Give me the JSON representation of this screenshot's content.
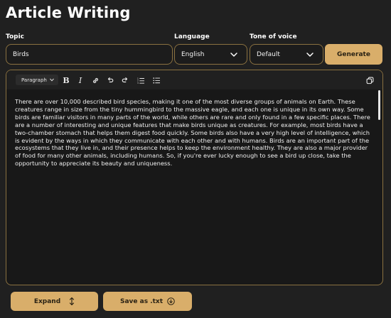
{
  "page": {
    "title": "Article Writing"
  },
  "topic": {
    "label": "Topic",
    "value": "Birds"
  },
  "language": {
    "label": "Language",
    "value": "English"
  },
  "tone": {
    "label": "Tone of voice",
    "value": "Default"
  },
  "generate_label": "Generate",
  "toolbar": {
    "format_value": "Paragraph",
    "icons": [
      "bold-icon",
      "italic-icon",
      "link-icon",
      "undo-icon",
      "redo-icon",
      "ordered-list-icon",
      "bullet-list-icon",
      "copy-icon"
    ]
  },
  "editor": {
    "content": "There are over 10,000 described bird species, making it one of the most diverse groups of animals on Earth. These creatures range in size from the tiny hummingbird to the massive eagle, and each one is unique in its own way. Some birds are familiar visitors in many parts of the world, while others are rare and only found in a few specific places. There are a number of interesting and unique features that make birds unique as creatures. For example, most birds have a two-chamber stomach that helps them digest food quickly. Some birds also have a very high level of intelligence, which is evident by the ways in which they communicate with each other and with humans. Birds are an important part of the ecosystems that they live in, and their presence helps to keep the environment healthy. They are also a major provider of food for many other animals, including humans. So, if you're ever lucky enough to see a bird up close, take the opportunity to appreciate its beauty and uniqueness."
  },
  "footer": {
    "expand_label": "Expand",
    "save_label": "Save as .txt"
  },
  "colors": {
    "accent": "#d9ae6a",
    "border": "#8a7140",
    "background": "#202020"
  }
}
